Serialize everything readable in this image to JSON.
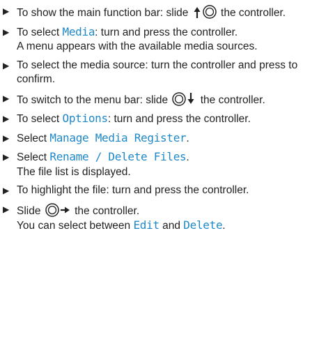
{
  "steps": [
    {
      "a": "To show the main function bar: slide ",
      "b": " the controller."
    },
    {
      "a": "To select ",
      "hl": "Media",
      "b": ": turn and press the controller.",
      "c": "A menu appears with the available media sources."
    },
    {
      "a": "To select the media source: turn the controller and press to confirm."
    },
    {
      "a": "To switch to the menu bar: slide ",
      "b": " the controller."
    },
    {
      "a": "To select ",
      "hl": "Options",
      "b": ": turn and press the controller."
    },
    {
      "a": "Select ",
      "hl": "Manage Media Register",
      "b": "."
    },
    {
      "a": "Select ",
      "hl": "Rename / Delete Files",
      "b": ".",
      "c": "The file list is displayed."
    },
    {
      "a": "To highlight the file: turn and press the controller."
    },
    {
      "a": "Slide ",
      "b": " the controller.",
      "c": "You can select between ",
      "hl1": "Edit",
      "d": " and ",
      "hl2": "Delete",
      "e": "."
    }
  ],
  "icons": {
    "marker": "bullet-triangle-icon",
    "slide_up": "controller-slide-up-icon",
    "slide_down": "controller-slide-down-icon",
    "slide_right": "controller-slide-right-icon"
  }
}
